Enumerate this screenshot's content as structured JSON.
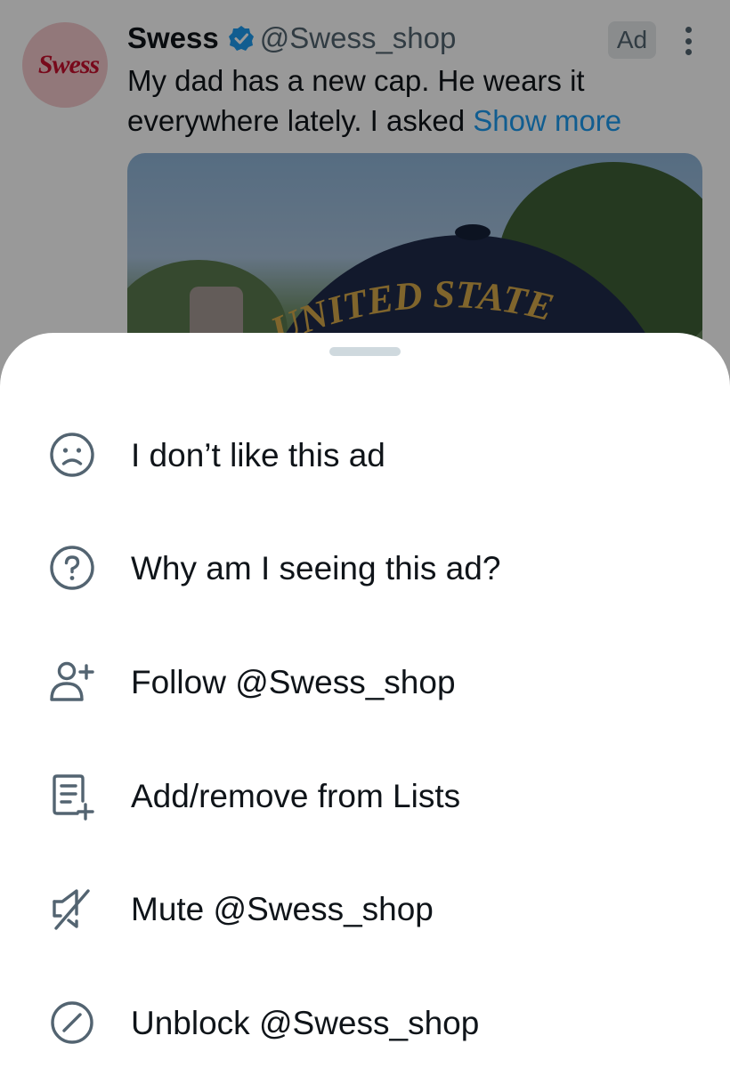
{
  "tweet": {
    "avatar_text": "Swess",
    "display_name": "Swess",
    "handle": "@Swess_shop",
    "ad_badge": "Ad",
    "text": "My dad has a new cap. He wears it everywhere lately. I asked ",
    "show_more": "Show more",
    "media_cap_text": "UNITED STATE"
  },
  "menu": {
    "items": [
      {
        "icon": "sad-face-icon",
        "label": "I don’t like this ad"
      },
      {
        "icon": "question-circle-icon",
        "label": "Why am I seeing this ad?"
      },
      {
        "icon": "follow-user-icon",
        "label": "Follow @Swess_shop"
      },
      {
        "icon": "list-add-icon",
        "label": "Add/remove from Lists"
      },
      {
        "icon": "mute-icon",
        "label": "Mute @Swess_shop"
      },
      {
        "icon": "unblock-icon",
        "label": "Unblock @Swess_shop"
      }
    ]
  },
  "colors": {
    "text": "#0f1419",
    "secondary": "#536471",
    "accent": "#1d9bf0",
    "brand": "#c8102e"
  }
}
